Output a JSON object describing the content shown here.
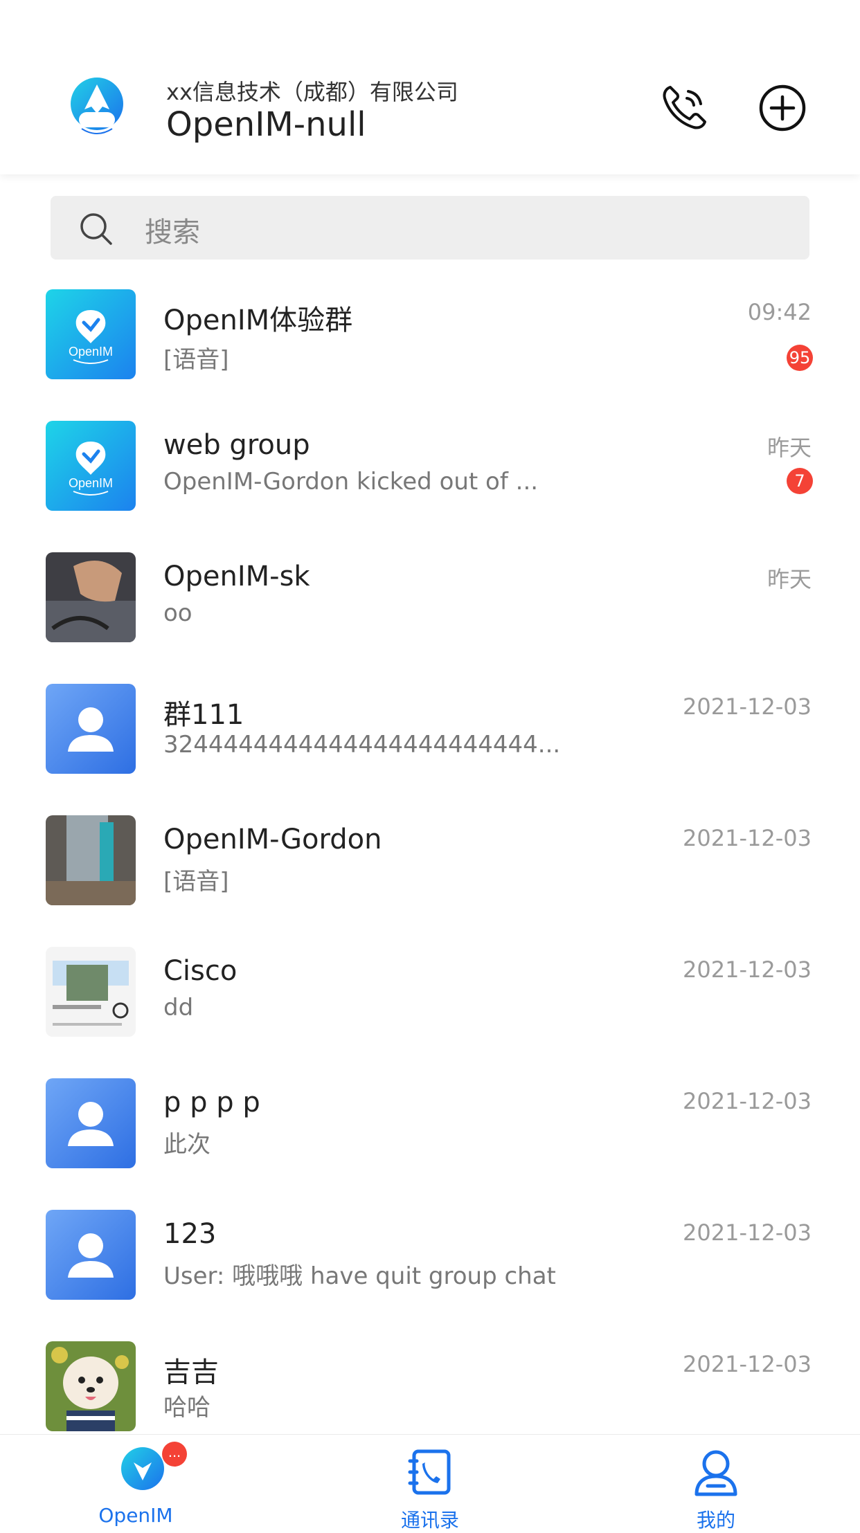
{
  "header": {
    "org_name": "xx信息技术（成都）有限公司",
    "user_name": "OpenIM-null",
    "logo_icon": "openim-logo-icon",
    "call_icon": "phone-call-icon",
    "add_icon": "plus-circle-icon"
  },
  "search": {
    "placeholder": "搜索",
    "icon": "search-icon"
  },
  "conversations": [
    {
      "name": "OpenIM体验群",
      "last_message": "[语音]",
      "time": "09:42",
      "unread": "95",
      "avatar": "openim-group-avatar"
    },
    {
      "name": "web group",
      "last_message": "OpenIM-Gordon  kicked out of ...",
      "time": "昨天",
      "unread": "7",
      "avatar": "openim-group-avatar"
    },
    {
      "name": "OpenIM-sk",
      "last_message": "oo",
      "time": "昨天",
      "unread": "",
      "avatar": "photo-avatar"
    },
    {
      "name": "群111",
      "last_message": "3244444444444444444444444...",
      "time": "2021-12-03",
      "unread": "",
      "avatar": "default-user-avatar"
    },
    {
      "name": "OpenIM-Gordon",
      "last_message": "[语音]",
      "time": "2021-12-03",
      "unread": "",
      "avatar": "photo-avatar"
    },
    {
      "name": "Cisco",
      "last_message": "dd",
      "time": "2021-12-03",
      "unread": "",
      "avatar": "photo-avatar"
    },
    {
      "name": "p p p p",
      "last_message": "此次",
      "time": "2021-12-03",
      "unread": "",
      "avatar": "default-user-avatar"
    },
    {
      "name": "123",
      "last_message": "User: 哦哦哦 have quit group chat",
      "time": "2021-12-03",
      "unread": "",
      "avatar": "default-user-avatar"
    },
    {
      "name": "吉吉",
      "last_message": "哈哈",
      "time": "2021-12-03",
      "unread": "",
      "avatar": "dog-photo-avatar"
    }
  ],
  "tabbar": {
    "tabs": [
      {
        "label": "OpenIM",
        "icon": "openim-chat-icon",
        "badge": "..."
      },
      {
        "label": "通讯录",
        "icon": "contacts-book-icon",
        "badge": ""
      },
      {
        "label": "我的",
        "icon": "user-profile-icon",
        "badge": ""
      }
    ]
  },
  "colors": {
    "accent": "#1b72ec",
    "badge": "#f44236",
    "search_bg": "#eeeeee"
  }
}
